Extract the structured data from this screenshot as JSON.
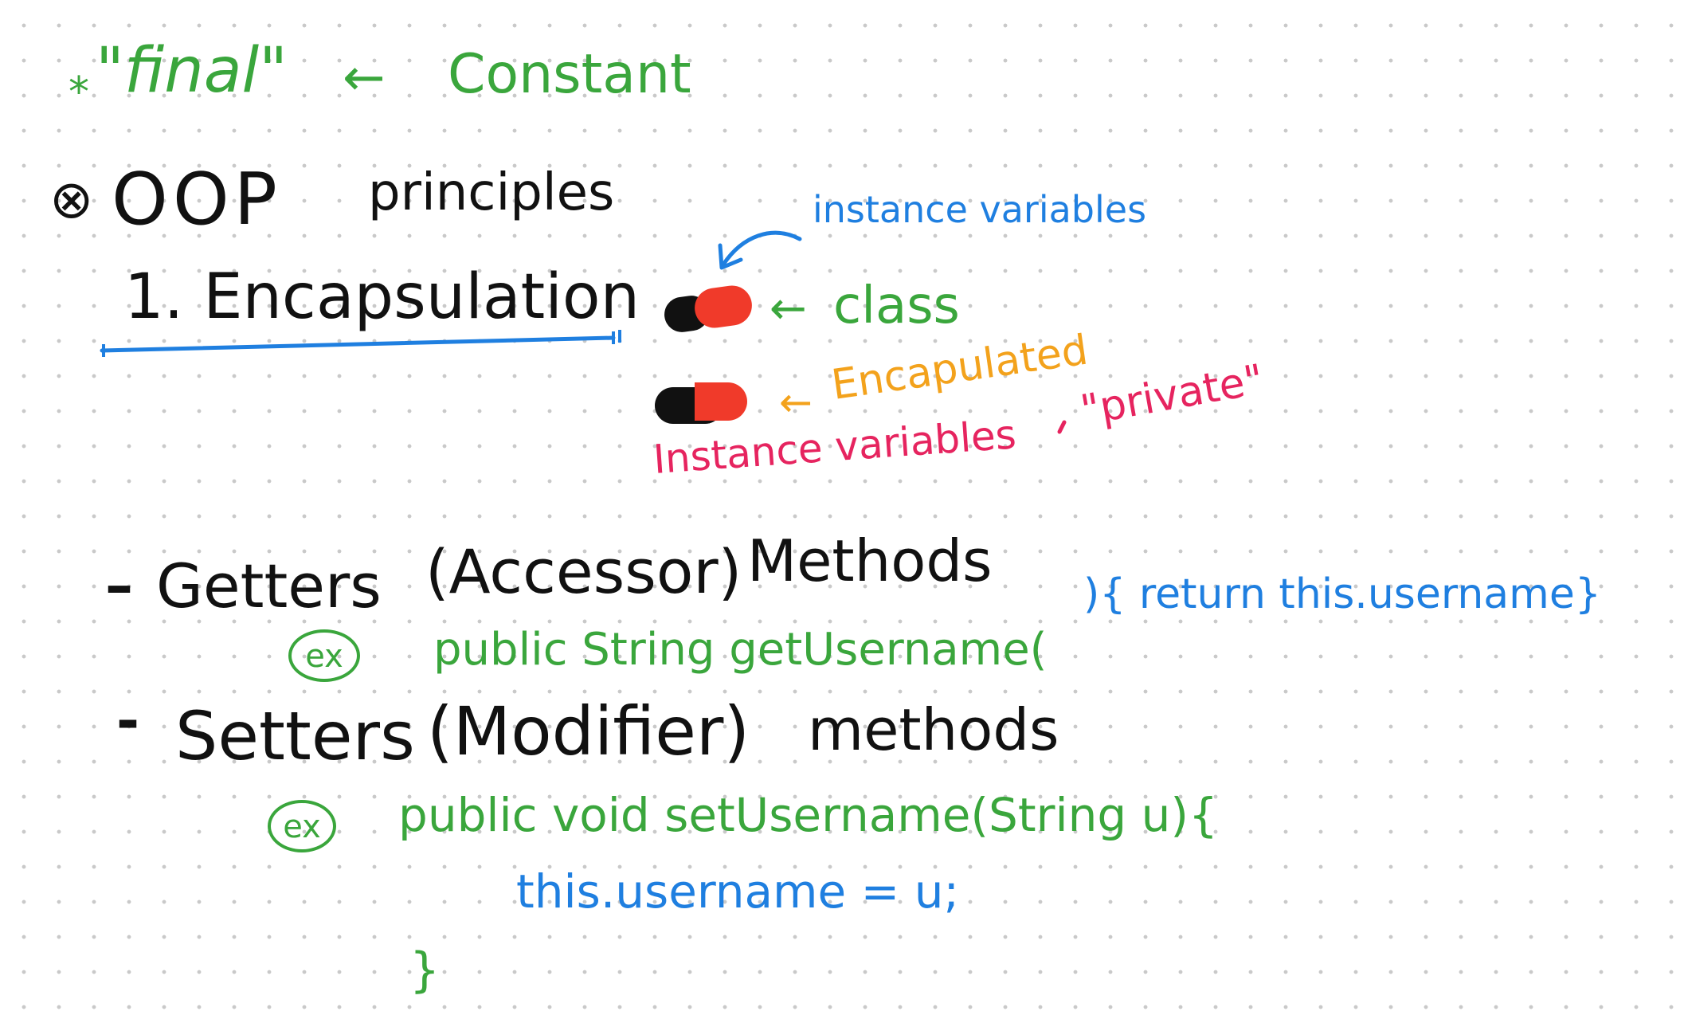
{
  "notes": {
    "final_line": {
      "star": "*",
      "keyword": "\"final\"",
      "arrow": "←",
      "meaning": "Constant"
    },
    "oop_heading": {
      "bullet": "⊗",
      "title": "OOP",
      "subtitle": "principles"
    },
    "encapsulation": {
      "heading": "1. Encapsulation",
      "instance_vars_label": "instance variables",
      "class_arrow": "←",
      "class_label": "class",
      "encapsulated_arrow": "←",
      "encapsulated_label": "Encapulated",
      "private_line_prefix": "Instance variables",
      "private_word": "\"private\""
    },
    "getters": {
      "dash": "–",
      "title": "Getters",
      "paren": "(Accessor)",
      "suffix": "Methods",
      "ex": "ex",
      "code_green": "public String getUsername(",
      "code_blue": "){ return this.username}"
    },
    "setters": {
      "dash": "-",
      "title": "Setters",
      "paren": "(Modifier)",
      "suffix": "methods",
      "ex": "ex",
      "code_green": "public void setUsername(String u){",
      "body_blue": "this.username = u;",
      "closing_brace": "}"
    }
  },
  "colors": {
    "green": "#3aa63c",
    "black": "#111111",
    "blue": "#1f7fe0",
    "orange": "#f3a21c",
    "pink": "#e6245f",
    "capsule_red": "#f03a2a",
    "capsule_black": "#111111"
  }
}
